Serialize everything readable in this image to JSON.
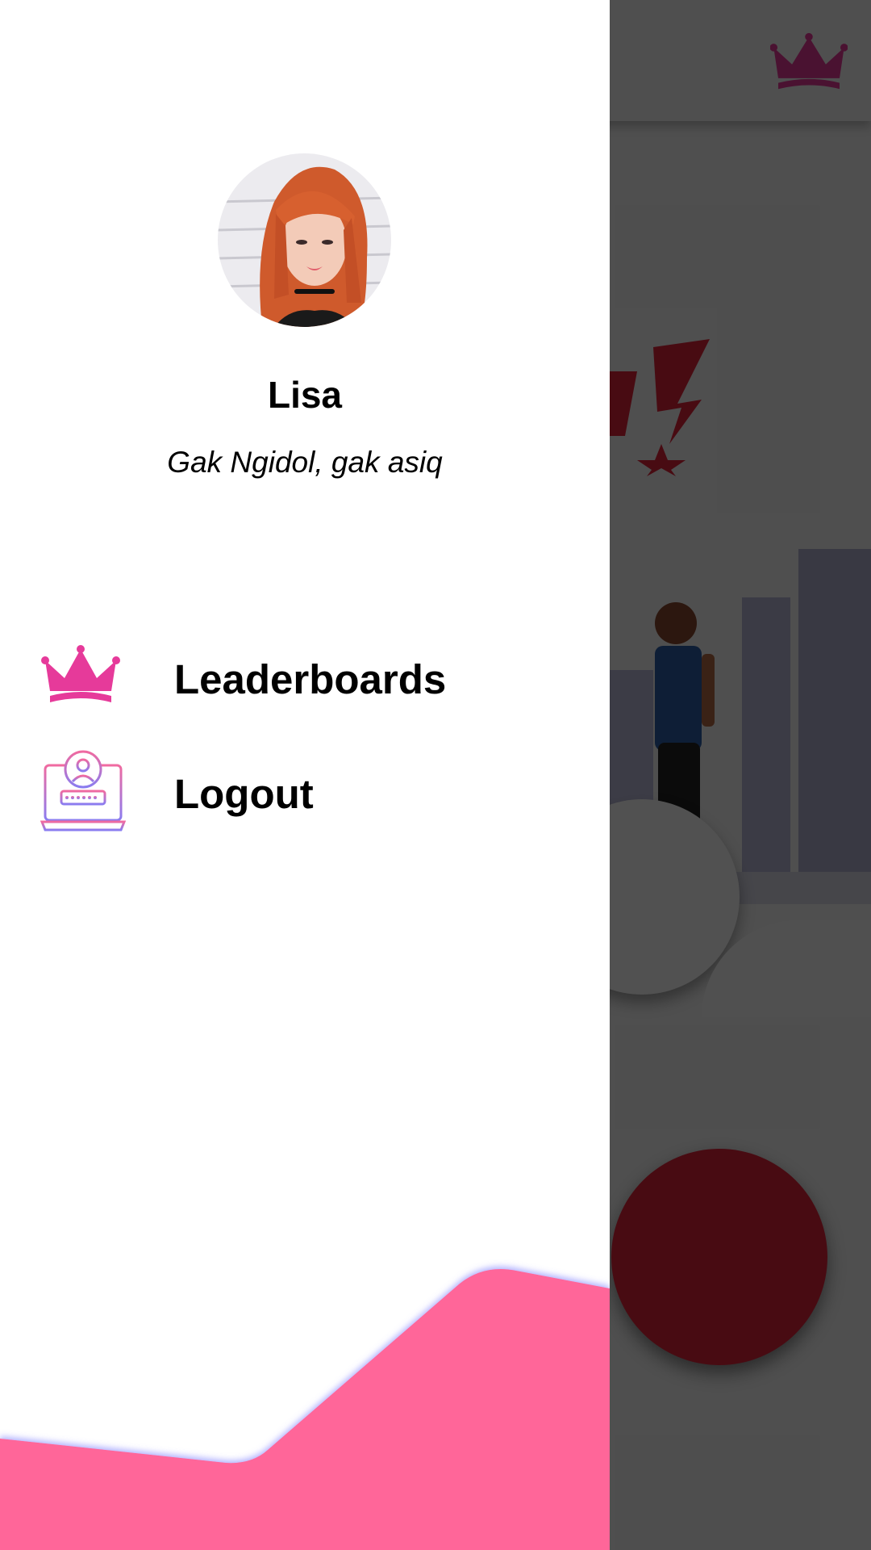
{
  "drawer": {
    "user": {
      "name": "Lisa",
      "status": "Gak Ngidol, gak asiq",
      "avatar_icon": "profile-photo"
    },
    "menu": [
      {
        "label": "Leaderboards",
        "icon": "crown-icon"
      },
      {
        "label": "Logout",
        "icon": "logout-laptop-icon"
      }
    ]
  },
  "app_bar": {
    "action_icon": "crown-icon"
  },
  "colors": {
    "accent_pink": "#e63a9a",
    "wave_pink": "#ff6699",
    "fab_red": "#e0243a",
    "scrim": "rgba(0,0,0,0.68)"
  }
}
